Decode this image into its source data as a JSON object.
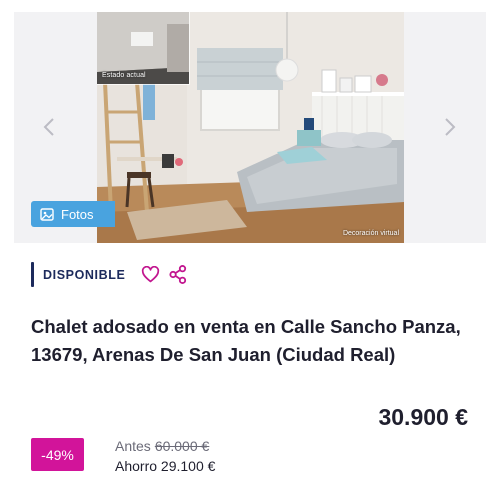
{
  "gallery": {
    "thumb_label": "Estado actual",
    "decor_label": "Decoración virtual",
    "photos_button_label": "Fotos",
    "nav_prev_icon": "chevron-left-icon",
    "nav_next_icon": "chevron-right-icon",
    "photos_icon": "image-icon"
  },
  "listing": {
    "status": "DISPONIBLE",
    "favorite_icon": "heart-icon",
    "share_icon": "share-icon",
    "title": "Chalet adosado en venta en Calle Sancho Panza, 13679, Arenas De San Juan (Ciudad Real)",
    "price": "30.900 €",
    "discount": "-49%",
    "before_label": "Antes",
    "before_price": "60.000 €",
    "saving": "Ahorro 29.100 €"
  },
  "colors": {
    "status_accent": "#1c2a5c",
    "discount_badge": "#d2149a",
    "photos_button": "#49a3df",
    "favorite_icon": "#c2168f"
  }
}
